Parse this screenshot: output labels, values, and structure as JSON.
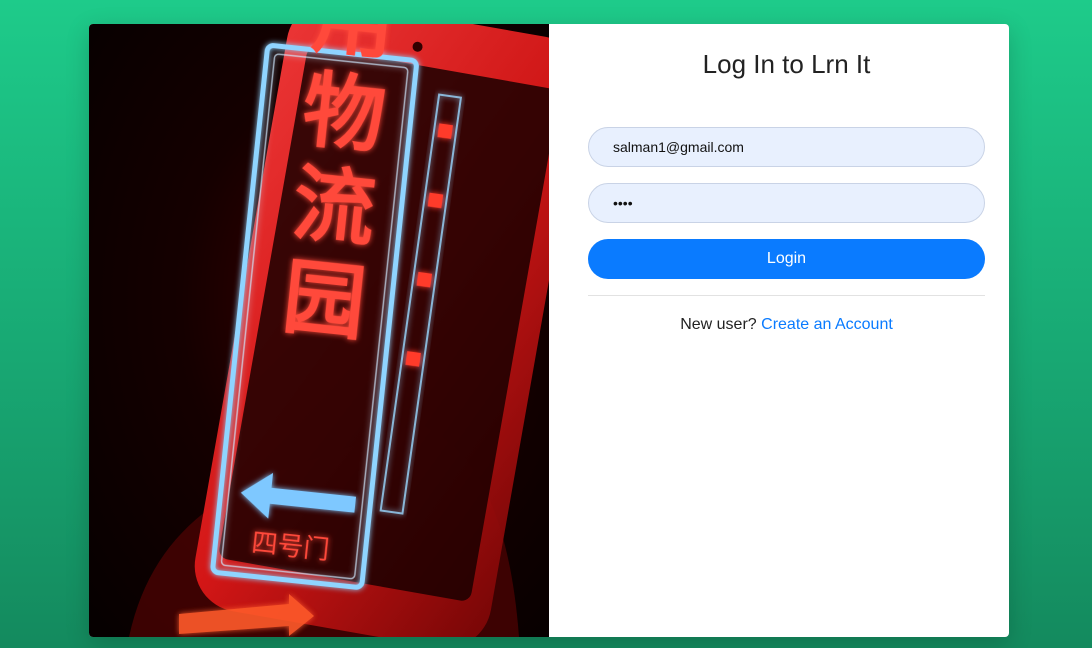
{
  "page": {
    "title": "Log In to Lrn It"
  },
  "form": {
    "email_value": "salman1@gmail.com",
    "password_value": "pass",
    "login_label": "Login"
  },
  "signup": {
    "prompt": "New user?",
    "link_label": "Create an Account"
  },
  "image": {
    "subject": "phone-with-neon-chinese-sign-photo",
    "sign_text": "用物流园",
    "sign_subtext": "四号门"
  },
  "colors": {
    "background": "#1ecb8a",
    "accent": "#0a7bff",
    "input_bg": "#e8f0fe"
  }
}
